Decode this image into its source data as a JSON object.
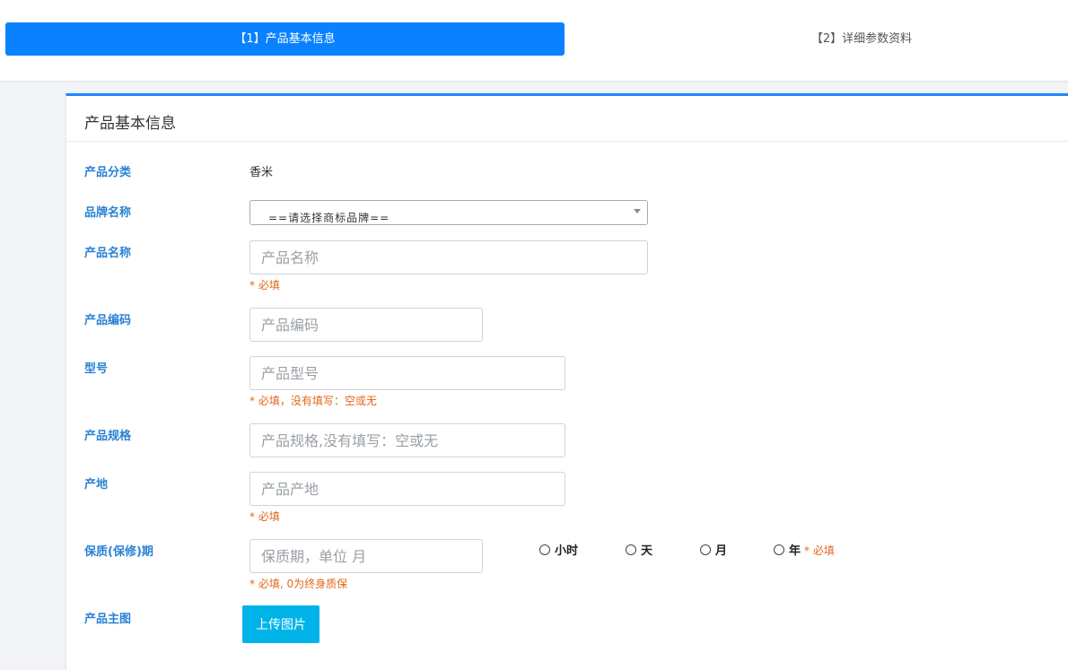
{
  "steps": {
    "step1": "【1】产品基本信息",
    "step2": "【2】详细参数资料"
  },
  "card": {
    "title": "产品基本信息"
  },
  "form": {
    "category": {
      "label": "产品分类",
      "value": "香米"
    },
    "brand": {
      "label": "品牌名称",
      "selected": "==请选择商标品牌=="
    },
    "name": {
      "label": "产品名称",
      "placeholder": "产品名称",
      "hint": "* 必填"
    },
    "code": {
      "label": "产品编码",
      "placeholder": "产品编码"
    },
    "model": {
      "label": "型号",
      "placeholder": "产品型号",
      "hint": "* 必填，没有填写：空或无"
    },
    "spec": {
      "label": "产品规格",
      "placeholder": "产品规格,没有填写：空或无"
    },
    "origin": {
      "label": "产地",
      "placeholder": "产品产地",
      "hint": "* 必填"
    },
    "warranty": {
      "label": "保质(保修)期",
      "placeholder": "保质期，单位 月",
      "hint": "* 必填, 0为终身质保",
      "units": [
        "小时",
        "天",
        "月",
        "年"
      ],
      "units_hint": "* 必填"
    },
    "main_image": {
      "label": "产品主图",
      "button": "上传图片"
    }
  },
  "colors": {
    "primary": "#0a82ff",
    "label": "#2a82d6",
    "hint": "#e2661a",
    "upload": "#00b4ea"
  }
}
